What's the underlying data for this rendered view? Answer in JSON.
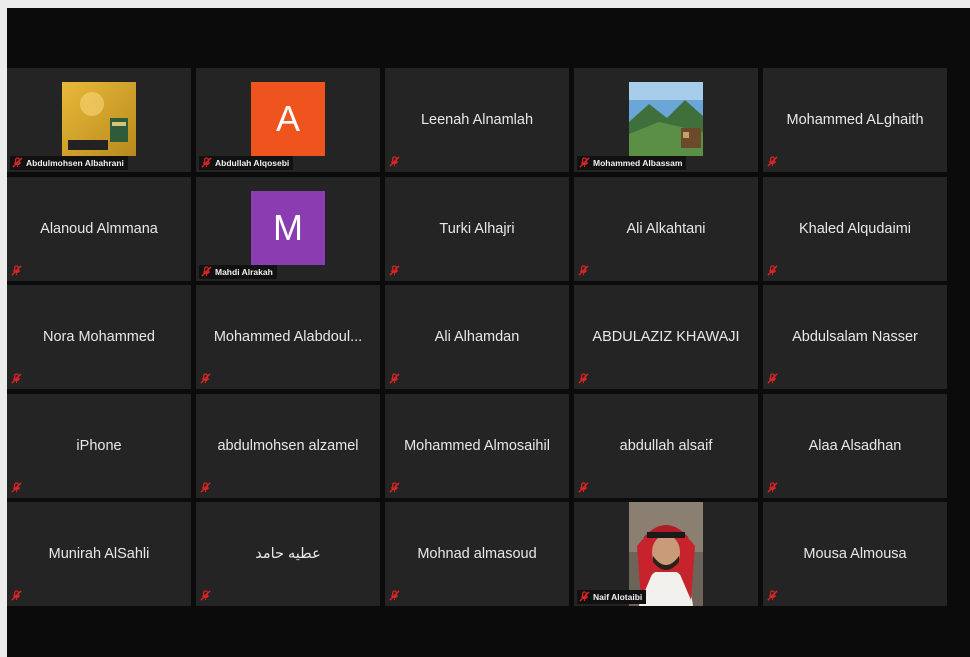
{
  "participants": [
    {
      "name": "Abdulmohsen Albahrani",
      "kind": "photo",
      "photo": "kaaba-icon",
      "muted": true
    },
    {
      "name": "Abdullah Alqosebi",
      "kind": "initial",
      "initial": "A",
      "avatar_color": "#f0541e",
      "muted": true
    },
    {
      "name": "Leenah Alnamlah",
      "kind": "name",
      "muted": true
    },
    {
      "name": "Mohammed Albassam",
      "kind": "photo",
      "photo": "landscape-icon",
      "muted": true
    },
    {
      "name": "Mohammed ALghaith",
      "kind": "name",
      "muted": true
    },
    {
      "name": "Alanoud Almmana",
      "kind": "name",
      "muted": true
    },
    {
      "name": "Mahdi Alrakah",
      "kind": "initial",
      "initial": "M",
      "avatar_color": "#8a3cb0",
      "muted": true
    },
    {
      "name": "Turki Alhajri",
      "kind": "name",
      "muted": true
    },
    {
      "name": "Ali Alkahtani",
      "kind": "name",
      "muted": true
    },
    {
      "name": "Khaled Alqudaimi",
      "kind": "name",
      "muted": true
    },
    {
      "name": "Nora Mohammed",
      "kind": "name",
      "muted": true
    },
    {
      "name": "Mohammed Alabdoul...",
      "kind": "name",
      "muted": true
    },
    {
      "name": "Ali Alhamdan",
      "kind": "name",
      "muted": true
    },
    {
      "name": "ABDULAZIZ KHAWAJI",
      "kind": "name",
      "muted": true
    },
    {
      "name": "Abdulsalam Nasser",
      "kind": "name",
      "muted": true
    },
    {
      "name": "iPhone",
      "kind": "name",
      "muted": true
    },
    {
      "name": "abdulmohsen alzamel",
      "kind": "name",
      "muted": true
    },
    {
      "name": "Mohammed Almosaihil",
      "kind": "name",
      "muted": true
    },
    {
      "name": "abdullah alsaif",
      "kind": "name",
      "muted": true
    },
    {
      "name": "Alaa Alsadhan",
      "kind": "name",
      "muted": true
    },
    {
      "name": "Munirah AlSahli",
      "kind": "name",
      "muted": true
    },
    {
      "name": "عطيه حامد",
      "kind": "name",
      "muted": true
    },
    {
      "name": "Mohnad almasoud",
      "kind": "name",
      "muted": true
    },
    {
      "name": "Naif Alotaibi",
      "kind": "video",
      "photo": "person-icon",
      "muted": true
    },
    {
      "name": "Mousa Almousa",
      "kind": "name",
      "muted": true
    }
  ],
  "colors": {
    "tile_bg": "#242424",
    "window_bg": "#0b0b0b",
    "mute_red": "#e02424"
  },
  "icons": {
    "muted": "muted-mic-icon"
  }
}
